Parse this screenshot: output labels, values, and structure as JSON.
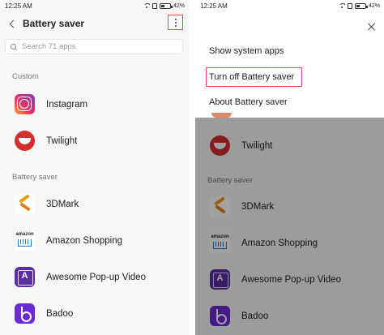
{
  "left": {
    "status": {
      "time": "12:25 AM",
      "battery": "42%"
    },
    "header": {
      "title": "Battery saver"
    },
    "search": {
      "placeholder": "Search 71 apps"
    },
    "sections": [
      {
        "title": "Custom",
        "apps": [
          {
            "name": "Instagram",
            "icon": "instagram-icon"
          },
          {
            "name": "Twilight",
            "icon": "twilight-icon"
          }
        ]
      },
      {
        "title": "Battery saver",
        "apps": [
          {
            "name": "3DMark",
            "icon": "3dmark-icon"
          },
          {
            "name": "Amazon Shopping",
            "icon": "amazon-icon"
          },
          {
            "name": "Awesome Pop-up Video",
            "icon": "awesome-popup-video-icon"
          },
          {
            "name": "Badoo",
            "icon": "badoo-icon"
          }
        ]
      }
    ]
  },
  "right": {
    "status": {
      "time": "12:25 AM",
      "battery": "42%"
    },
    "menu": [
      {
        "label": "Show system apps"
      },
      {
        "label": "Turn off Battery saver"
      },
      {
        "label": "About Battery saver"
      }
    ],
    "list": {
      "apps_top": [
        {
          "name": "Twilight"
        }
      ],
      "section_title": "Battery saver",
      "apps": [
        {
          "name": "3DMark"
        },
        {
          "name": "Amazon Shopping"
        },
        {
          "name": "Awesome Pop-up Video"
        },
        {
          "name": "Badoo"
        }
      ]
    }
  },
  "colors": {
    "highlight_box": "#e34c4c",
    "background": "#f7f7f7"
  },
  "amazon_logo_text": "amazon"
}
